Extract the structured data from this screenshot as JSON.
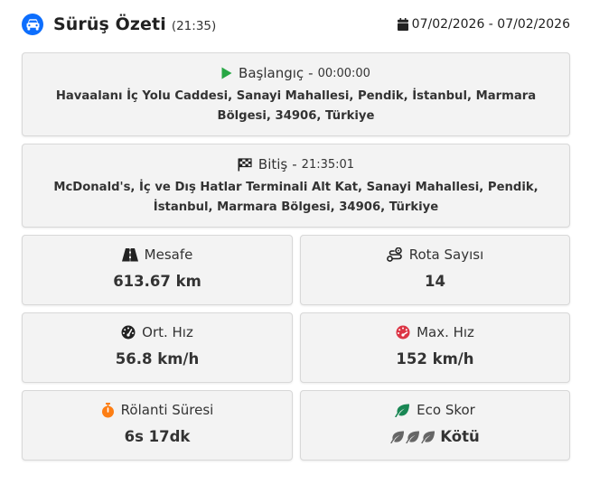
{
  "header": {
    "title": "Sürüş Özeti",
    "time": "(21:35)",
    "date_range": "07/02/2026 - 07/02/2026"
  },
  "start": {
    "label": "Başlangıç",
    "separator": "-",
    "time": "00:00:00",
    "address": "Havaalanı İç Yolu Caddesi, Sanayi Mahallesi, Pendik, İstanbul, Marmara Bölgesi, 34906, Türkiye"
  },
  "end": {
    "label": "Bitiş",
    "separator": "-",
    "time": "21:35:01",
    "address": "McDonald's, İç ve Dış Hatlar Terminali Alt Kat, Sanayi Mahallesi, Pendik, İstanbul, Marmara Bölgesi, 34906, Türkiye"
  },
  "stats": {
    "distance": {
      "label": "Mesafe",
      "value": "613.67 km",
      "icon": "road-icon"
    },
    "route_count": {
      "label": "Rota Sayısı",
      "value": "14",
      "icon": "route-icon"
    },
    "avg_speed": {
      "label": "Ort. Hız",
      "value": "56.8 km/h",
      "icon": "gauge-icon"
    },
    "max_speed": {
      "label": "Max. Hız",
      "value": "152 km/h",
      "icon": "speedometer-icon"
    },
    "idle_time": {
      "label": "Rölanti Süresi",
      "value": "6s 17dk",
      "icon": "stopwatch-icon"
    },
    "eco_score": {
      "label": "Eco Skor",
      "value": "Kötü",
      "icon": "leaf-icon"
    }
  },
  "colors": {
    "accent": "#0d6efd",
    "start_green": "#28a745",
    "max_speed_red": "#dc3545",
    "idle_orange": "#fd7e14",
    "eco_green": "#198754"
  }
}
